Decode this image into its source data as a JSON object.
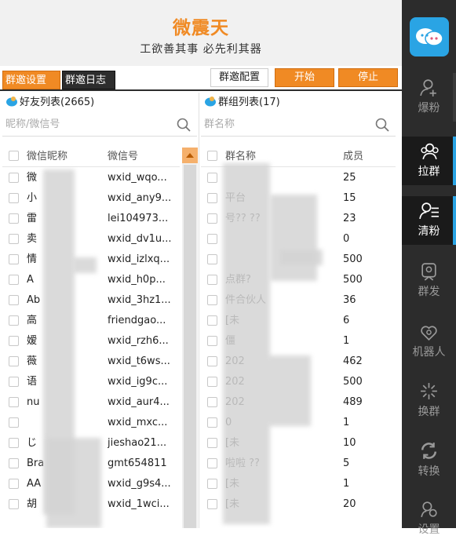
{
  "app": {
    "title": "微震天",
    "slogan": "工欲善其事 必先利其器"
  },
  "tabs": [
    {
      "label": "群邀设置"
    },
    {
      "label": "群邀日志"
    }
  ],
  "toolbar": {
    "config_label": "群邀配置",
    "start_label": "开始",
    "stop_label": "停止"
  },
  "friends": {
    "title": "好友列表(2665)",
    "search_placeholder": "昵称/微信号",
    "headers": [
      "微信昵称",
      "微信号"
    ],
    "rows": [
      {
        "nick": "微",
        "wxid": "wxid_wqo..."
      },
      {
        "nick": "小",
        "wxid": "wxid_any9..."
      },
      {
        "nick": "雷",
        "wxid": "lei104973..."
      },
      {
        "nick": "卖",
        "wxid": "wxid_dv1u..."
      },
      {
        "nick": "情",
        "wxid": "wxid_izlxq..."
      },
      {
        "nick": "A",
        "wxid": "wxid_h0p..."
      },
      {
        "nick": "Ab",
        "wxid": "wxid_3hz1..."
      },
      {
        "nick": "高",
        "wxid": "friendgao..."
      },
      {
        "nick": "嫒",
        "wxid": "wxid_rzh6..."
      },
      {
        "nick": "薇",
        "wxid": "wxid_t6ws..."
      },
      {
        "nick": "语",
        "wxid": "wxid_ig9c..."
      },
      {
        "nick": "nu",
        "wxid": "wxid_aur4..."
      },
      {
        "nick": "",
        "wxid": "wxid_mxc..."
      },
      {
        "nick": "じ",
        "wxid": "jieshao21..."
      },
      {
        "nick": "Bra",
        "wxid": "gmt654811"
      },
      {
        "nick": "AA",
        "wxid": "wxid_g9s4..."
      },
      {
        "nick": "胡",
        "wxid": "wxid_1wci..."
      }
    ]
  },
  "groups": {
    "title": "群组列表(17)",
    "search_placeholder": "群名称",
    "headers": [
      "群名称",
      "成员"
    ],
    "rows": [
      {
        "name": "",
        "count": "25"
      },
      {
        "name": "平台",
        "count": "15"
      },
      {
        "name": "号?? ??",
        "count": "23"
      },
      {
        "name": "",
        "count": "0"
      },
      {
        "name": "",
        "count": "500"
      },
      {
        "name": "点群?",
        "count": "500"
      },
      {
        "name": "件合伙人",
        "count": "36"
      },
      {
        "name": "[未",
        "count": "6"
      },
      {
        "name": "僵",
        "count": "1"
      },
      {
        "name": "202",
        "count": "462"
      },
      {
        "name": "202",
        "count": "500"
      },
      {
        "name": "202",
        "count": "489"
      },
      {
        "name": "0",
        "count": "1"
      },
      {
        "name": "[未",
        "count": "10"
      },
      {
        "name": "啦啦 ??",
        "count": "5"
      },
      {
        "name": "[未",
        "count": "1"
      },
      {
        "name": "[未",
        "count": "20"
      }
    ]
  },
  "sidebar": {
    "items": [
      {
        "label": "爆粉",
        "icon": "user-plus-icon"
      },
      {
        "label": "拉群",
        "icon": "group-icon"
      },
      {
        "label": "清粉",
        "icon": "user-list-icon"
      },
      {
        "label": "群发",
        "icon": "broadcast-icon"
      },
      {
        "label": "机器人",
        "icon": "robot-icon"
      },
      {
        "label": "换群",
        "icon": "sparkle-icon"
      },
      {
        "label": "转换",
        "icon": "convert-icon"
      },
      {
        "label": "设置",
        "icon": "gear-icon"
      }
    ]
  },
  "colors": {
    "accent": "#f08a24",
    "sidebar": "#2c2c2c",
    "logo": "#2aa4e4"
  }
}
